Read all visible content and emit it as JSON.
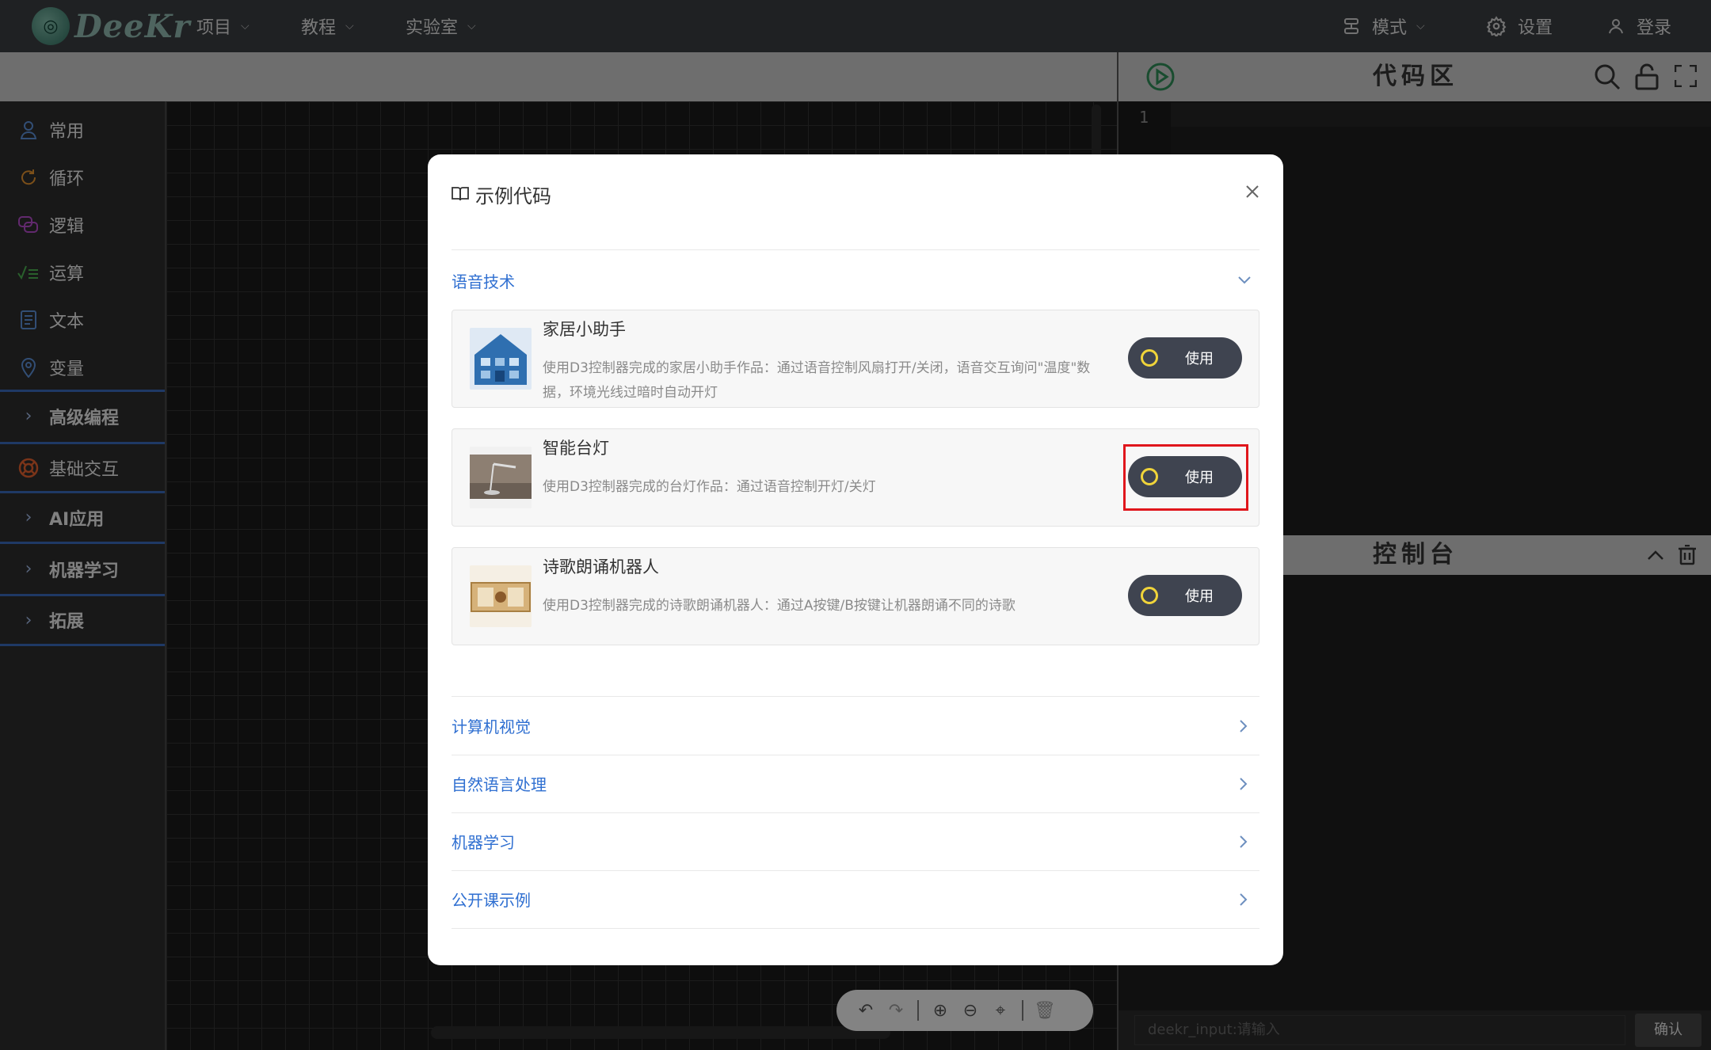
{
  "nav": {
    "brand": "DeeKr",
    "menus": [
      {
        "label": "项目"
      },
      {
        "label": "教程"
      },
      {
        "label": "实验室"
      }
    ],
    "mode_label": "模式",
    "settings_label": "设置",
    "login_label": "登录"
  },
  "sidebar": {
    "items": [
      {
        "label": "常用",
        "icon": "person-icon",
        "color": "#5b8fd6"
      },
      {
        "label": "循环",
        "icon": "loop-icon",
        "color": "#e0902f"
      },
      {
        "label": "逻辑",
        "icon": "logic-icon",
        "color": "#b34cc9"
      },
      {
        "label": "运算",
        "icon": "math-icon",
        "color": "#4caf50"
      },
      {
        "label": "文本",
        "icon": "document-icon",
        "color": "#5b8fd6"
      },
      {
        "label": "变量",
        "icon": "location-pin-icon",
        "color": "#5b8fd6"
      }
    ],
    "groups": [
      {
        "label": "高级编程"
      },
      {
        "label": "基础交互",
        "icon": "lifebuoy-icon",
        "color": "#e0602f"
      },
      {
        "label": "AI应用"
      },
      {
        "label": "机器学习"
      },
      {
        "label": "拓展"
      }
    ]
  },
  "code_panel": {
    "title": "代码区",
    "line_number": "1"
  },
  "console": {
    "title": "控制台",
    "input_placeholder": "deekr_input:请输入",
    "confirm_label": "确认"
  },
  "modal": {
    "title": "示例代码",
    "expanded_section": {
      "label": "语音技术",
      "cards": [
        {
          "title": "家居小助手",
          "desc": "使用D3控制器完成的家居小助手作品：通过语音控制风扇打开/关闭，语音交互询问\"温度\"数据，环境光线过暗时自动开灯",
          "button": "使用"
        },
        {
          "title": "智能台灯",
          "desc": "使用D3控制器完成的台灯作品：通过语音控制开灯/关灯",
          "button": "使用"
        },
        {
          "title": "诗歌朗诵机器人",
          "desc": "使用D3控制器完成的诗歌朗诵机器人：通过A按键/B按键让机器朗诵不同的诗歌",
          "button": "使用"
        }
      ]
    },
    "collapsed_sections": [
      {
        "label": "计算机视觉"
      },
      {
        "label": "自然语言处理"
      },
      {
        "label": "机器学习"
      },
      {
        "label": "公开课示例"
      }
    ]
  },
  "colors": {
    "accent_blue": "#2f6fd1",
    "use_button": "#3f4450",
    "ring": "#f0d43a",
    "highlight": "#e0161c"
  }
}
